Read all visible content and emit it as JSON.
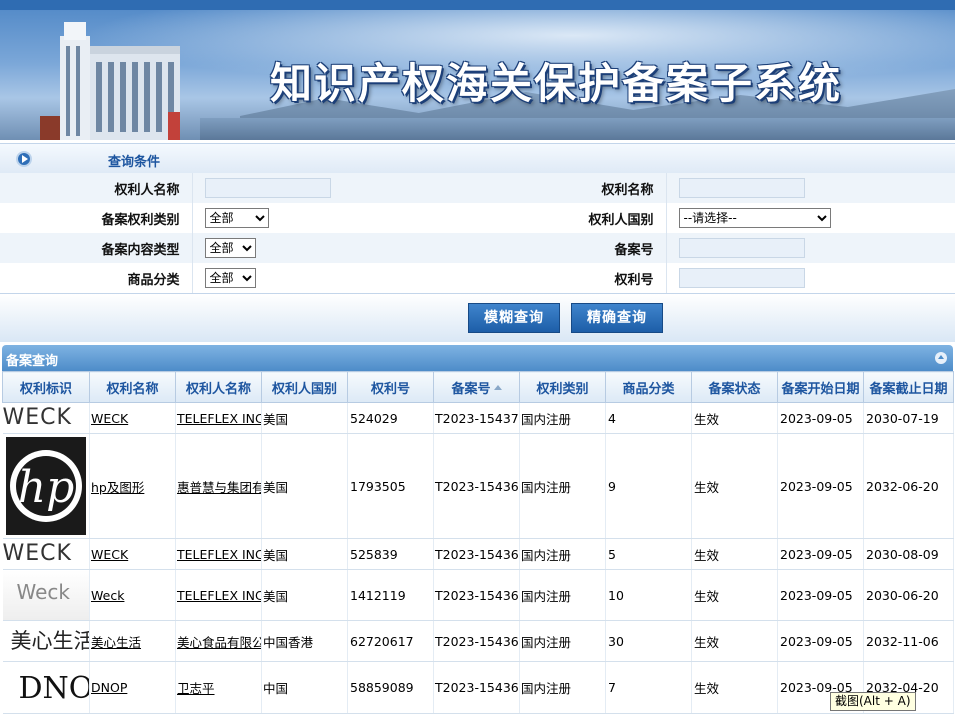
{
  "banner": {
    "title": "知识产权海关保护备案子系统"
  },
  "query": {
    "header_title": "查询条件",
    "fields": {
      "right_holder_name": {
        "label": "权利人名称",
        "value": ""
      },
      "right_name": {
        "label": "权利名称",
        "value": ""
      },
      "right_type": {
        "label": "备案权利类别",
        "selected": "全部"
      },
      "holder_country": {
        "label": "权利人国别",
        "selected": "--请选择--"
      },
      "content_type": {
        "label": "备案内容类型",
        "selected": "全部"
      },
      "record_no": {
        "label": "备案号",
        "value": ""
      },
      "goods_class": {
        "label": "商品分类",
        "selected": "全部"
      },
      "right_no": {
        "label": "权利号",
        "value": ""
      }
    },
    "buttons": {
      "fuzzy": "模糊查询",
      "exact": "精确查询"
    }
  },
  "results": {
    "header_title": "备案查询",
    "columns": [
      "权利标识",
      "权利名称",
      "权利人名称",
      "权利人国别",
      "权利号",
      "备案号",
      "权利类别",
      "商品分类",
      "备案状态",
      "备案开始日期",
      "备案截止日期"
    ],
    "rows": [
      {
        "logo": "WECK",
        "name": "WECK",
        "holder": "TELEFLEX INCORPORATED",
        "country": "美国",
        "right_no": "524029",
        "record_no": "T2023-15437",
        "type": "国内注册",
        "goods": "4",
        "status": "生效",
        "start": "2023-09-05",
        "end": "2030-07-19"
      },
      {
        "logo": "hp",
        "name": "hp及图形",
        "holder": "惠普慧与集团有限公司",
        "country": "美国",
        "right_no": "1793505",
        "record_no": "T2023-15436",
        "type": "国内注册",
        "goods": "9",
        "status": "生效",
        "start": "2023-09-05",
        "end": "2032-06-20"
      },
      {
        "logo": "WECK",
        "name": "WECK",
        "holder": "TELEFLEX INCORPORATED",
        "country": "美国",
        "right_no": "525839",
        "record_no": "T2023-15436",
        "type": "国内注册",
        "goods": "5",
        "status": "生效",
        "start": "2023-09-05",
        "end": "2030-08-09"
      },
      {
        "logo": "Weck",
        "name": "Weck",
        "holder": "TELEFLEX INCORPORATED",
        "country": "美国",
        "right_no": "1412119",
        "record_no": "T2023-15436",
        "type": "国内注册",
        "goods": "10",
        "status": "生效",
        "start": "2023-09-05",
        "end": "2030-06-20"
      },
      {
        "logo": "美心生活",
        "name": "美心生活",
        "holder": "美心食品有限公司",
        "country": "中国香港",
        "right_no": "62720617",
        "record_no": "T2023-15436",
        "type": "国内注册",
        "goods": "30",
        "status": "生效",
        "start": "2023-09-05",
        "end": "2032-11-06"
      },
      {
        "logo": "DNOP",
        "name": "DNOP",
        "holder": "卫志平",
        "country": "中国",
        "right_no": "58859089",
        "record_no": "T2023-15436",
        "type": "国内注册",
        "goods": "7",
        "status": "生效",
        "start": "2023-09-05",
        "end": "2032-04-20"
      }
    ]
  },
  "tooltip": {
    "text": "截图(Alt + A)"
  }
}
